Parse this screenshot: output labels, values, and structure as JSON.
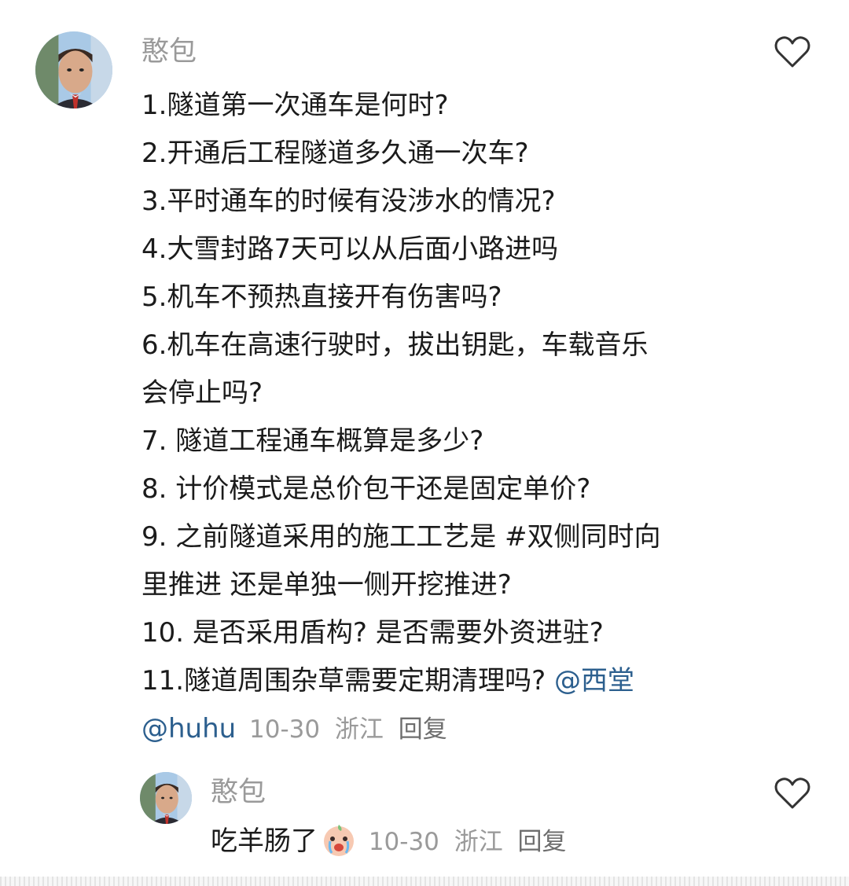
{
  "comment1": {
    "username": "憨包",
    "lines": [
      "1.隧道第一次通车是何时?",
      "2.开通后工程隧道多久通一次车?",
      "3.平时通车的时候有没涉水的情况?",
      "4.大雪封路7天可以从后面小路进吗",
      "5.机车不预热直接开有伤害吗?",
      "6.机车在高速行驶时，拔出钥匙，车载音乐",
      "会停止吗?",
      "7. 隧道工程通车概算是多少?",
      "8. 计价模式是总价包干还是固定单价?",
      "9. 之前隧道采用的施工工艺是 #双侧同时向",
      "里推进 还是单独一侧开挖推进?",
      "10. 是否采用盾构? 是否需要外资进驻?"
    ],
    "last_line_text": "11.隧道周围杂草需要定期清理吗? ",
    "mention1": "@西堂",
    "mention2": "@huhu",
    "date": "10-30",
    "location": "浙江",
    "reply_label": "回复"
  },
  "comment2": {
    "username": "憨包",
    "text": "吃羊肠了",
    "emoji": "crying-face-emoji",
    "date": "10-30",
    "location": "浙江",
    "reply_label": "回复"
  },
  "colors": {
    "mention": "#2c5f8e",
    "meta": "#9a9a9a",
    "text": "#1b1b1b"
  }
}
